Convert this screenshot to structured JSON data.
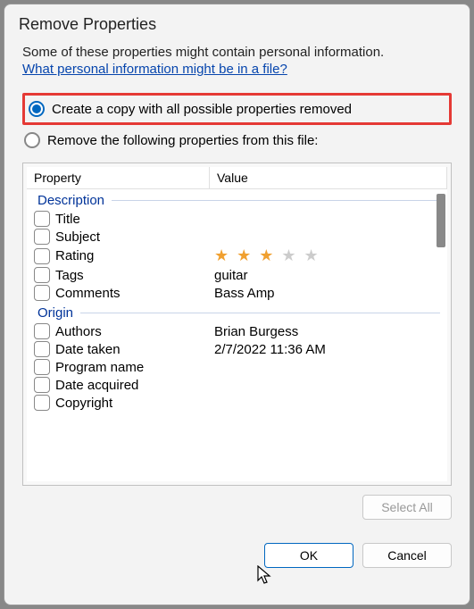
{
  "title": "Remove Properties",
  "info": "Some of these properties might contain personal information.",
  "link": "What personal information might be in a file?",
  "radio": {
    "opt1": "Create a copy with all possible properties removed",
    "opt2": "Remove the following properties from this file:"
  },
  "columns": {
    "property": "Property",
    "value": "Value"
  },
  "groups": {
    "description": "Description",
    "origin": "Origin"
  },
  "props": {
    "title": {
      "name": "Title",
      "value": ""
    },
    "subject": {
      "name": "Subject",
      "value": ""
    },
    "rating": {
      "name": "Rating",
      "stars": 3
    },
    "tags": {
      "name": "Tags",
      "value": "guitar"
    },
    "comments": {
      "name": "Comments",
      "value": "Bass Amp"
    },
    "authors": {
      "name": "Authors",
      "value": "Brian Burgess"
    },
    "date_taken": {
      "name": "Date taken",
      "value": "2/7/2022 11:36 AM"
    },
    "program_name": {
      "name": "Program name",
      "value": ""
    },
    "date_acquired": {
      "name": "Date acquired",
      "value": ""
    },
    "copyright": {
      "name": "Copyright",
      "value": ""
    }
  },
  "buttons": {
    "select_all": "Select All",
    "ok": "OK",
    "cancel": "Cancel"
  }
}
